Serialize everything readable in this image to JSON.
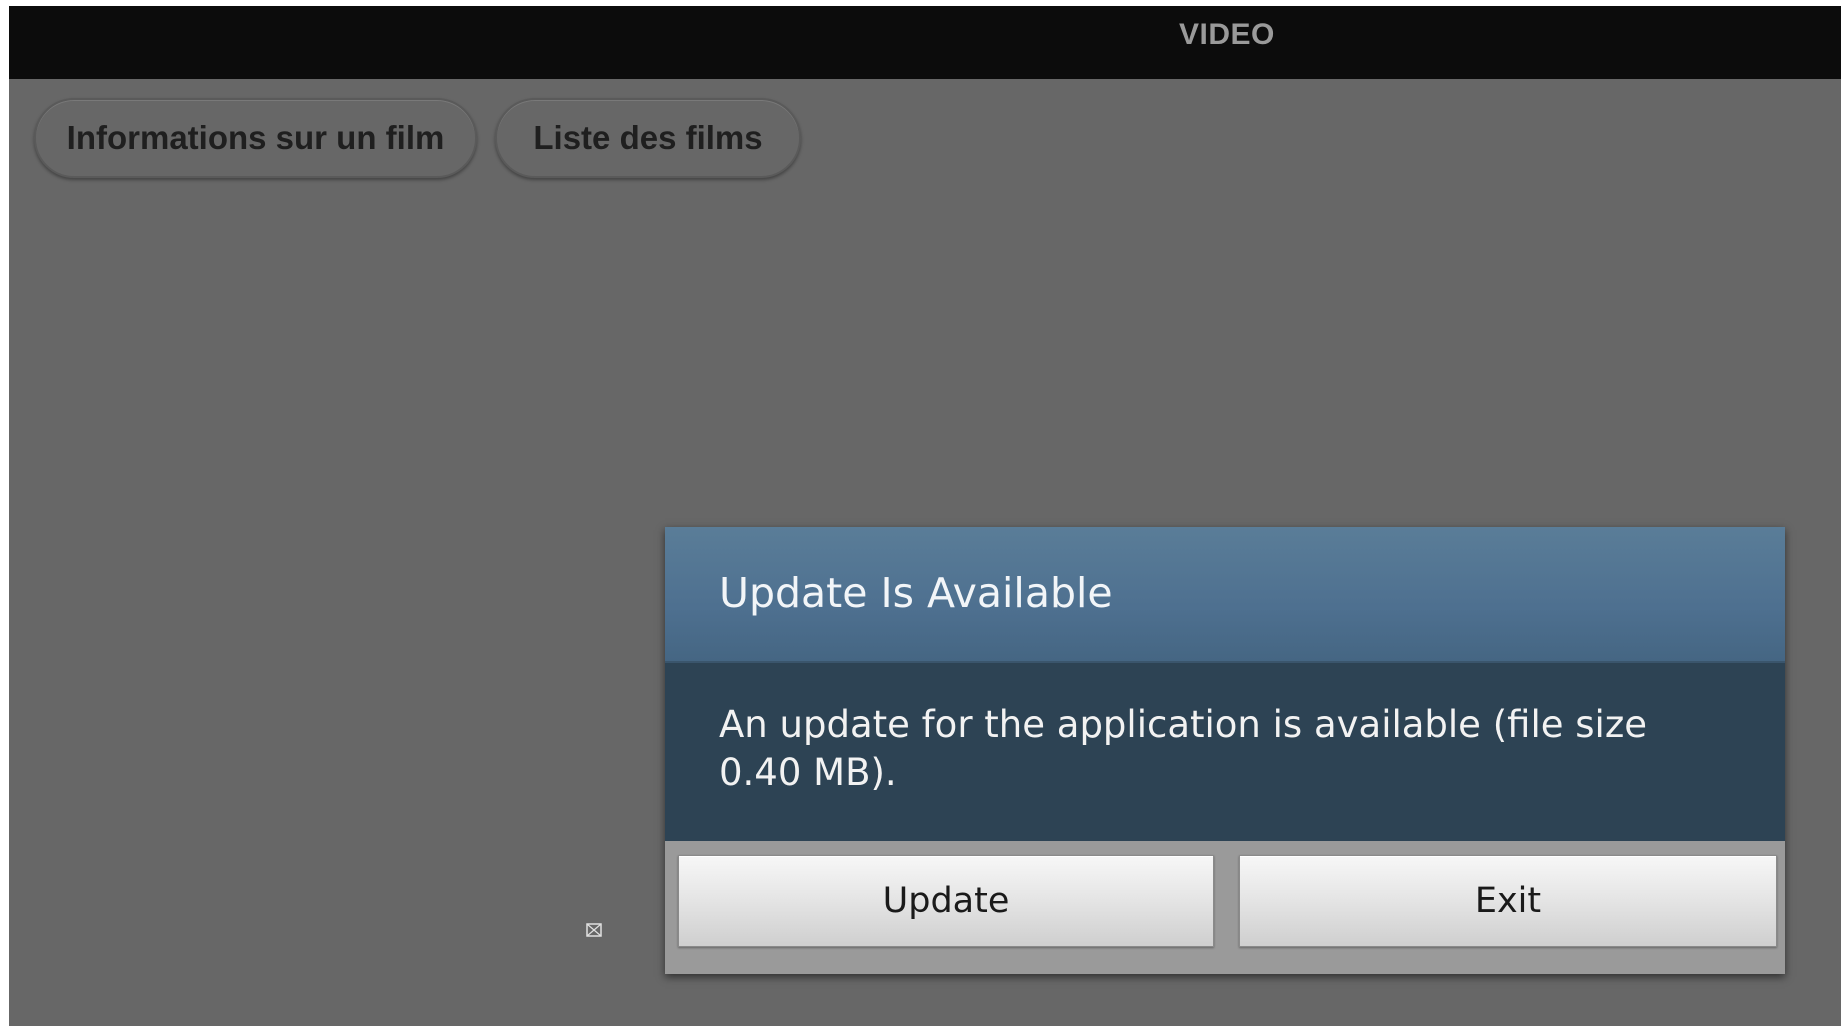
{
  "app": {
    "title": "VIDEO"
  },
  "nav": {
    "buttons": [
      {
        "label": "Informations sur un film"
      },
      {
        "label": "Liste des films"
      }
    ]
  },
  "dialog": {
    "title": "Update Is Available",
    "message": "An update for the application is available (file size 0.40 MB).",
    "buttons": {
      "update": "Update",
      "exit": "Exit"
    }
  },
  "icons": {
    "small": "image-placeholder-icon"
  },
  "colors": {
    "background": "#676767",
    "titlebar": "#0c0c0c",
    "dialog_header": "#4e7090",
    "dialog_body": "#2d4354"
  }
}
